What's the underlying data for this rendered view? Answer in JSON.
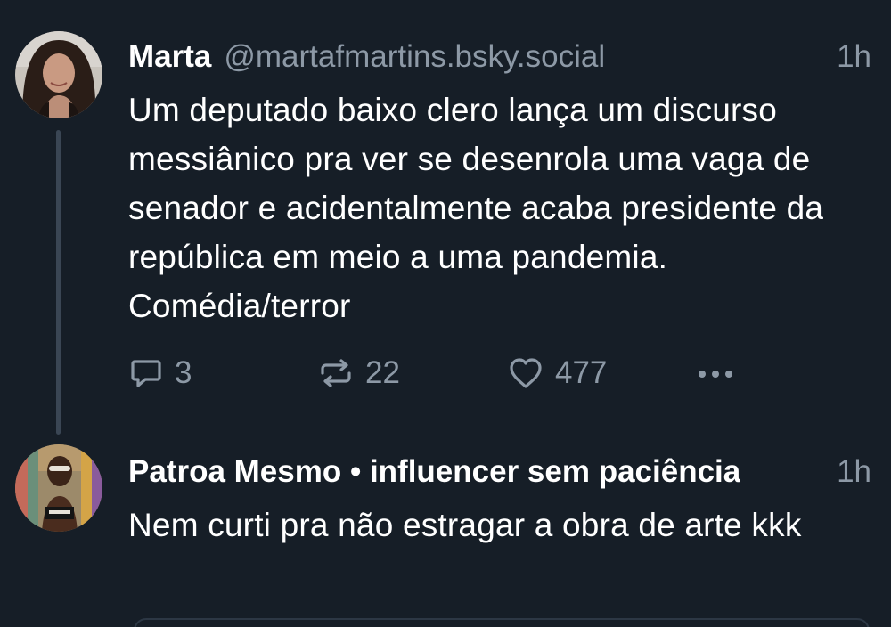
{
  "thread": {
    "post1": {
      "display_name": "Marta",
      "handle": "@martafmartins.bsky.social",
      "timestamp": "1h",
      "text": "Um deputado baixo clero lança um discurso messiânico pra ver se desenrola uma vaga de senador e acidentalmente acaba presidente da república em meio a uma pandemia. Comédia/terror",
      "reply_count": "3",
      "repost_count": "22",
      "like_count": "477",
      "icons": {
        "reply": "reply-icon",
        "repost": "repost-icon",
        "like": "heart-icon",
        "more": "more-options-icon"
      }
    },
    "post2": {
      "display_name": "Patroa Mesmo • influencer sem paciência",
      "timestamp": "1h",
      "text": "Nem curti pra não estragar a obra de arte kkk"
    }
  },
  "colors": {
    "background": "#161e27",
    "primary_text": "#ffffff",
    "secondary_text": "#8d99a6",
    "thread_line": "#3a4654"
  }
}
